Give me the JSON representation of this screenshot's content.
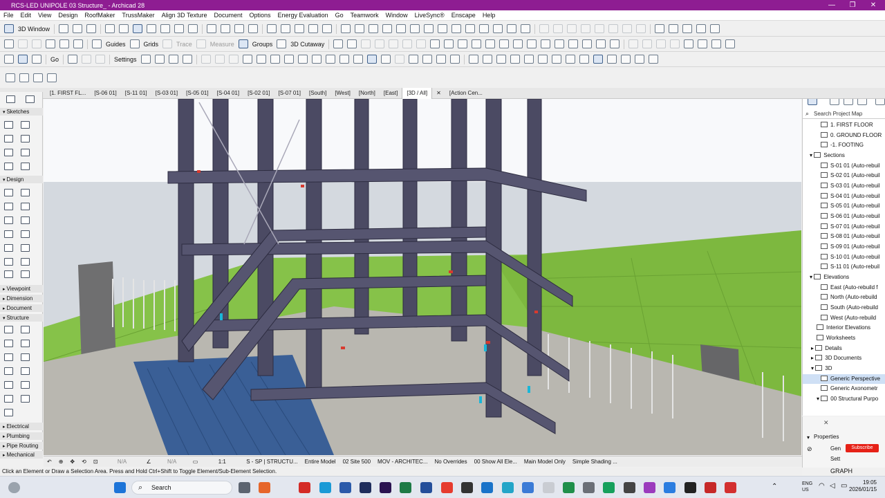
{
  "window": {
    "title": "RCS-LED UNIPOLE 03 Structure_ - Archicad 28",
    "minimize": "—",
    "maximize": "❐",
    "close": "✕"
  },
  "menu": [
    "File",
    "Edit",
    "View",
    "Design",
    "RoofMaker",
    "TrussMaker",
    "Align 3D Texture",
    "Document",
    "Options",
    "Energy Evaluation",
    "Go",
    "Teamwork",
    "Window",
    "LiveSync®",
    "Enscape",
    "Help"
  ],
  "toolbar1": {
    "view_button": "3D Window"
  },
  "toolbar2": {
    "guides": "Guides",
    "grids": "Grids",
    "trace": "Trace",
    "measure": "Measure",
    "groups": "Groups",
    "cutaway": "3D Cutaway"
  },
  "toolbar3": {
    "go": "Go",
    "settings": "Settings"
  },
  "tabs": [
    "[1. FIRST FL...",
    "[S-06 01]",
    "[S-11 01]",
    "[S-03 01]",
    "[S-05 01]",
    "[S-04 01]",
    "[S-02 01]",
    "[S-07 01]",
    "[South]",
    "[West]",
    "[North]",
    "[East]",
    "[3D / All]",
    "[Action Cen..."
  ],
  "toolbox": {
    "sketches": "Sketches",
    "design": "Design",
    "viewpoint": "Viewpoint",
    "dimension": "Dimension",
    "document": "Document",
    "structure": "Structure",
    "electrical": "Electrical",
    "plumbing": "Plumbing",
    "pipe_routing": "Pipe Routing",
    "mechanical": "Mechanical"
  },
  "navigator": {
    "search_placeholder": "Search Project Map",
    "stories": [
      "1. FIRST FLOOR",
      "0. GROUND FLOOR",
      "-1. FOOTING"
    ],
    "sections_label": "Sections",
    "sections": [
      "S-01 01 (Auto-rebuil",
      "S-02 01 (Auto-rebuil",
      "S-03 01 (Auto-rebuil",
      "S-04 01 (Auto-rebuil",
      "S-05 01 (Auto-rebuil",
      "S-06 01 (Auto-rebuil",
      "S-07 01 (Auto-rebuil",
      "S-08 01 (Auto-rebuil",
      "S-09 01 (Auto-rebuil",
      "S-10 01 (Auto-rebuil",
      "S-11 01 (Auto-rebuil"
    ],
    "elevations_label": "Elevations",
    "elevations": [
      "East (Auto-rebuild f",
      "North (Auto-rebuild",
      "South (Auto-rebuild",
      "West (Auto-rebuild"
    ],
    "others": [
      "Interior Elevations",
      "Worksheets",
      "Details",
      "3D Documents",
      "3D"
    ],
    "threed": [
      "Generic Perspective",
      "Generic Axonometr",
      "00 Structural Purpo"
    ]
  },
  "properties": {
    "header": "Properties",
    "row1": "Gen",
    "row2": "Sett",
    "subscribe": "Subscribe",
    "graph": "GRAPH"
  },
  "bottombar": {
    "na1": "N/A",
    "na2": "N/A",
    "scale": "1:1",
    "structure": "S - SP | STRUCTU...",
    "model": "Entire Model",
    "site": "02 Site 500",
    "mov": "MOV - ARCHITEC...",
    "overrides": "No Overrides",
    "show": "00 Show All Ele...",
    "main": "Main Model Only",
    "shading": "Simple Shading ..."
  },
  "status": "Click an Element or Draw a Selection Area. Press and Hold Ctrl+Shift to Toggle Element/Sub-Element Selection.",
  "taskbar": {
    "search": "Search",
    "lang1": "ENG",
    "lang2": "US",
    "time": "19:05",
    "date": "2026/01/15"
  }
}
